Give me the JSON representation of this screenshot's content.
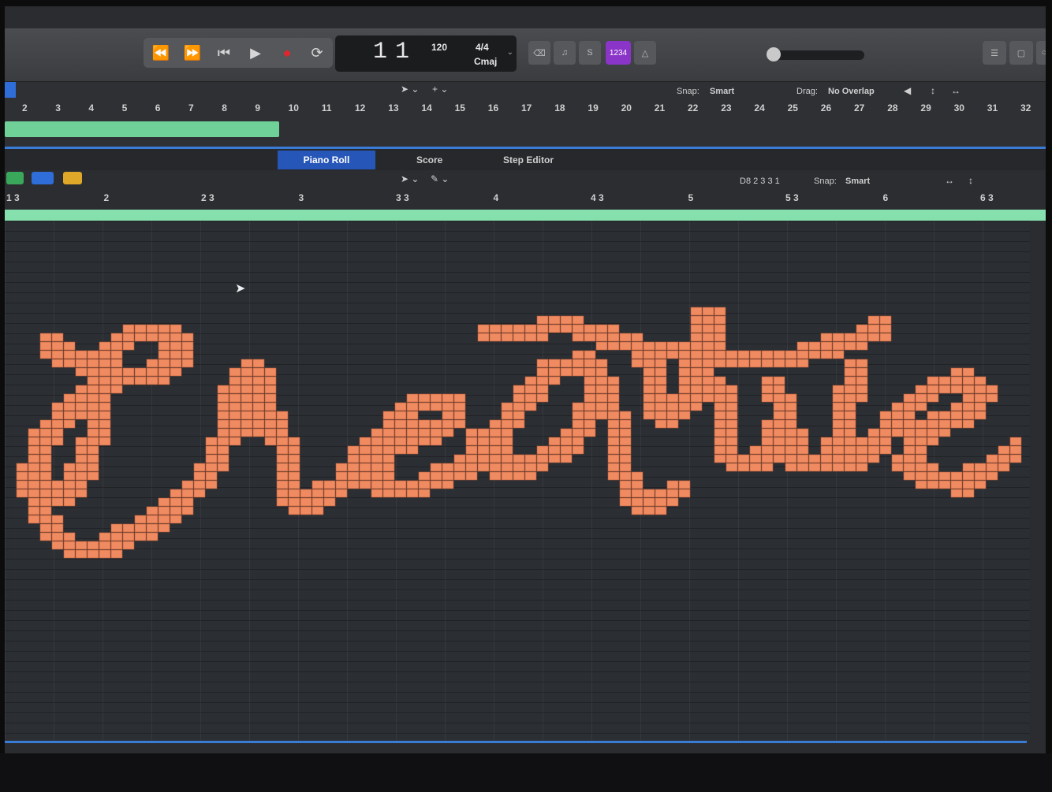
{
  "transport": {
    "rewind_icon": "⏪",
    "forward_icon": "⏩",
    "to_start_icon": "⏮",
    "play_icon": "▶",
    "record_icon": "●",
    "cycle_icon": "⟳"
  },
  "lcd": {
    "bar": "1",
    "beat": "1",
    "tempo": "120",
    "time_signature": "4/4",
    "key": "Cmaj"
  },
  "toolbar": {
    "count_in_label": "1234"
  },
  "ruler": {
    "bars": [
      "2",
      "3",
      "4",
      "5",
      "6",
      "7",
      "8",
      "9",
      "10",
      "11",
      "12",
      "13",
      "14",
      "15",
      "16",
      "17",
      "18",
      "19",
      "20",
      "21",
      "22",
      "23",
      "24",
      "25",
      "26",
      "27",
      "28",
      "29",
      "30",
      "31",
      "32"
    ]
  },
  "tracks_toolbar": {
    "snap_label": "Snap:",
    "snap_value": "Smart",
    "drag_label": "Drag:",
    "drag_value": "No Overlap"
  },
  "editor_tabs": [
    "Piano Roll",
    "Score",
    "Step Editor"
  ],
  "editor_header": {
    "position": "D8  2 3 3 1",
    "snap_label": "Snap:",
    "snap_value": "Smart"
  },
  "editor_ruler": {
    "marks": [
      "1 3",
      "2",
      "2 3",
      "3",
      "3 3",
      "4",
      "4 3",
      "5",
      "5 3",
      "6",
      "6 3"
    ]
  },
  "colors": {
    "note": "#f08a60",
    "region": "#6fd098",
    "tab_active": "#2656b8",
    "record": "#e0262c",
    "accent": "#8a34c8"
  }
}
